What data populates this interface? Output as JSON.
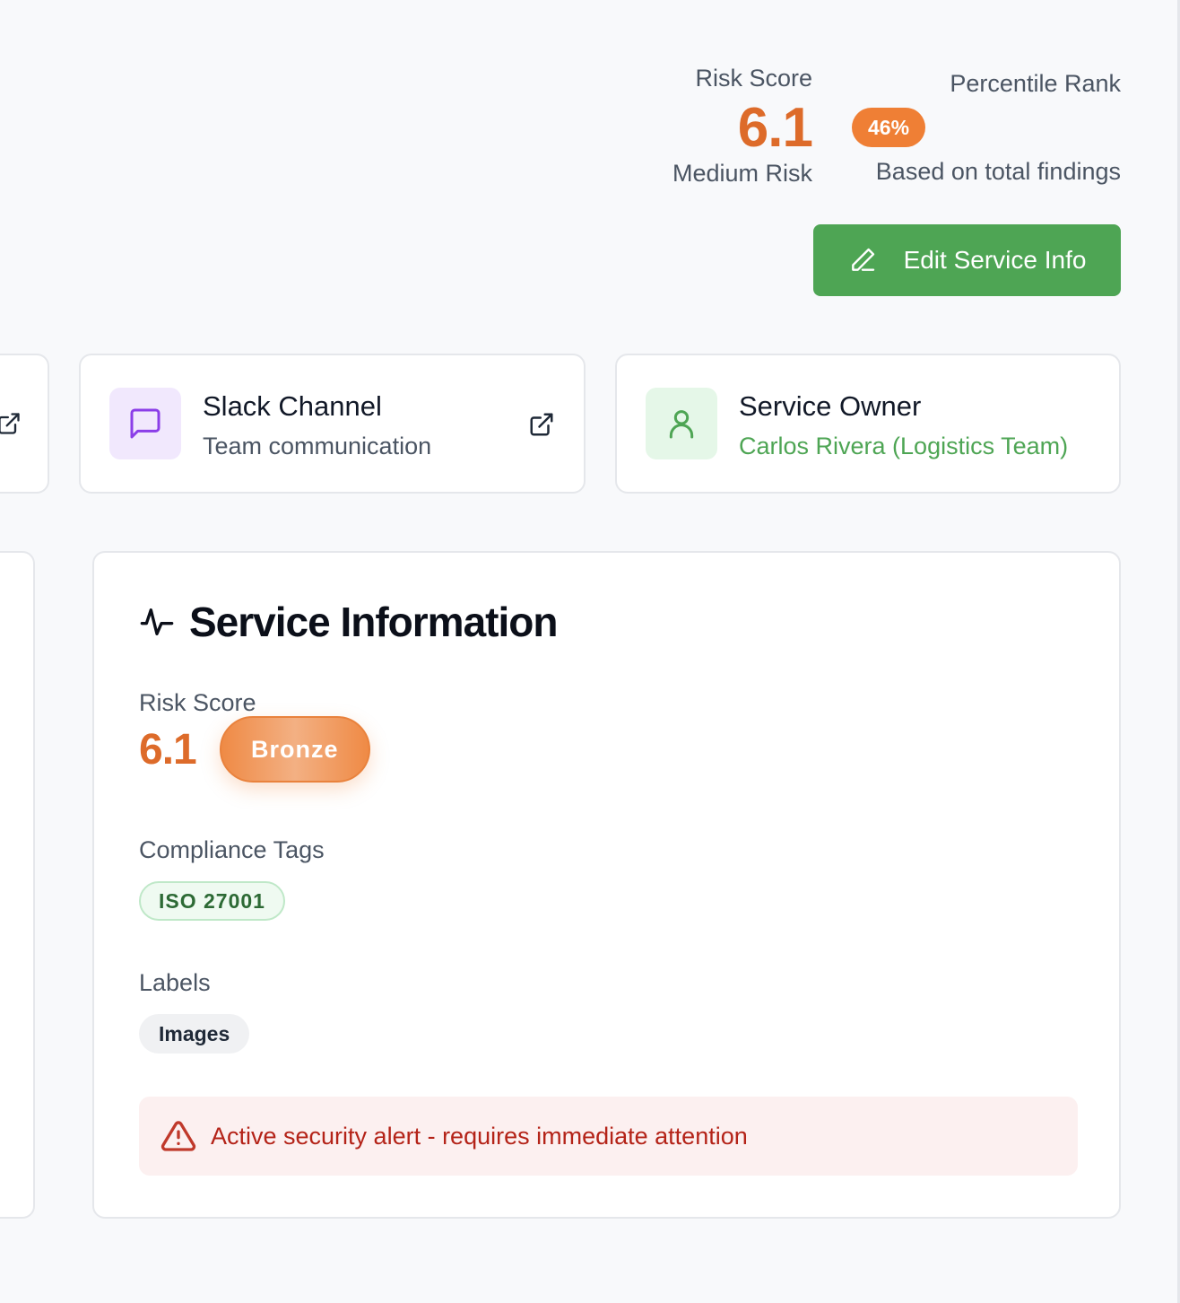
{
  "header": {
    "risk": {
      "label": "Risk Score",
      "value": "6.1",
      "level": "Medium Risk"
    },
    "percentile": {
      "label": "Percentile Rank",
      "value": "46%",
      "subtext": "Based on total findings"
    },
    "edit_button_label": "Edit Service Info"
  },
  "links": {
    "slack": {
      "title": "Slack Channel",
      "subtitle": "Team communication",
      "icon": "message-square-icon"
    },
    "owner": {
      "title": "Service Owner",
      "subtitle": "Carlos Rivera (Logistics Team)",
      "icon": "user-icon"
    }
  },
  "service_info": {
    "title": "Service Information",
    "risk_score_label": "Risk Score",
    "risk_score_value": "6.1",
    "tier_badge": "Bronze",
    "compliance_label": "Compliance Tags",
    "compliance_tags": [
      "ISO 27001"
    ],
    "labels_label": "Labels",
    "labels": [
      "Images"
    ],
    "alert_text": "Active security alert - requires immediate attention"
  },
  "colors": {
    "accent_orange": "#dd6b2a",
    "primary_green": "#4ea554",
    "alert_red": "#b42318"
  }
}
